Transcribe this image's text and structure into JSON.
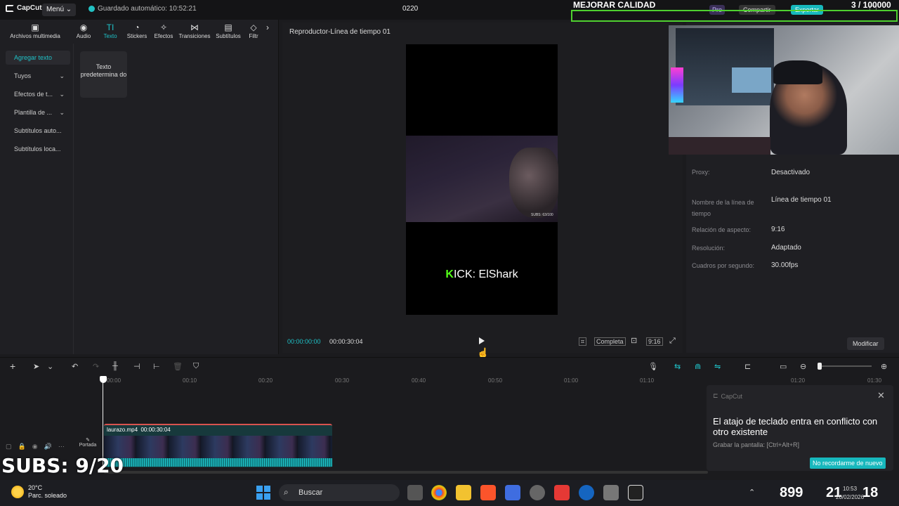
{
  "titlebar": {
    "app_name": "CapCut",
    "menu_label": "Menú",
    "autosave_label": "Guardado automático: 10:52:21",
    "project_name": "0220",
    "overlay_title": "MEJORAR CALIDAD",
    "counter": "3  / 100000",
    "pro_label": "Pro",
    "share_label": "Compartir",
    "export_label": "Exportar"
  },
  "tabs": [
    {
      "label": "Archivos multimedia",
      "icon": "media-icon"
    },
    {
      "label": "Audio",
      "icon": "audio-icon"
    },
    {
      "label": "Texto",
      "icon": "text-icon",
      "active": true
    },
    {
      "label": "Stickers",
      "icon": "sticker-icon"
    },
    {
      "label": "Efectos",
      "icon": "effects-icon"
    },
    {
      "label": "Transiciones",
      "icon": "transitions-icon"
    },
    {
      "label": "Subtítulos",
      "icon": "subtitles-icon"
    },
    {
      "label": "Filtr",
      "icon": "filters-icon"
    }
  ],
  "subnav": [
    {
      "label": "Agregar texto",
      "active": true
    },
    {
      "label": "Tuyos"
    },
    {
      "label": "Efectos de t..."
    },
    {
      "label": "Plantilla de ..."
    },
    {
      "label": "Subtítulos auto..."
    },
    {
      "label": "Subtítulos loca..."
    }
  ],
  "text_card": "Texto predetermina do",
  "player": {
    "title": "Reproductor-Línea de tiempo 01",
    "current_time": "00:00:00:00",
    "duration": "00:00:30:04",
    "full_label": "Completa",
    "ratio_label": "9:16",
    "kick_k": "K",
    "kick_text": "ICK: ElShark",
    "subs_small": "SUBS: 63/100"
  },
  "properties": {
    "rows": [
      {
        "label": "Proxy:",
        "value": "Desactivado"
      },
      {
        "label": "Nombre de la línea de tiempo",
        "value": "Línea de tiempo 01"
      },
      {
        "label": "Relación de aspecto:",
        "value": "9:16"
      },
      {
        "label": "Resolución:",
        "value": "Adaptado"
      },
      {
        "label": "Cuadros por segundo:",
        "value": "30.00fps"
      }
    ],
    "modify_label": "Modificar"
  },
  "ruler_ticks": [
    "00:00",
    "00:10",
    "00:20",
    "00:30",
    "00:40",
    "00:50",
    "01:00",
    "01:10",
    "01:20",
    "01:30"
  ],
  "timeline": {
    "clip_name": "laurazo.mp4",
    "clip_duration": "00:00:30:04",
    "cover_label": "Portada",
    "subs_overlay": "SUBS: 9/20"
  },
  "toast": {
    "app": "CapCut",
    "title": "El atajo de teclado entra en conflicto con otro existente",
    "subtitle": "Grabar la pantalla: [Ctrl+Alt+R]",
    "button": "No recordarme de nuevo"
  },
  "taskbar": {
    "temp": "20°C",
    "weather": "Parc. soleado",
    "search_placeholder": "Buscar",
    "tray_a": "899",
    "tray_b": "21",
    "tray_c": "18",
    "time": "10:53",
    "date": "20/02/2026"
  },
  "colors": {
    "accent": "#1fc2c8",
    "kick_green": "#53fc18",
    "frame_green": "#4ed02f"
  }
}
